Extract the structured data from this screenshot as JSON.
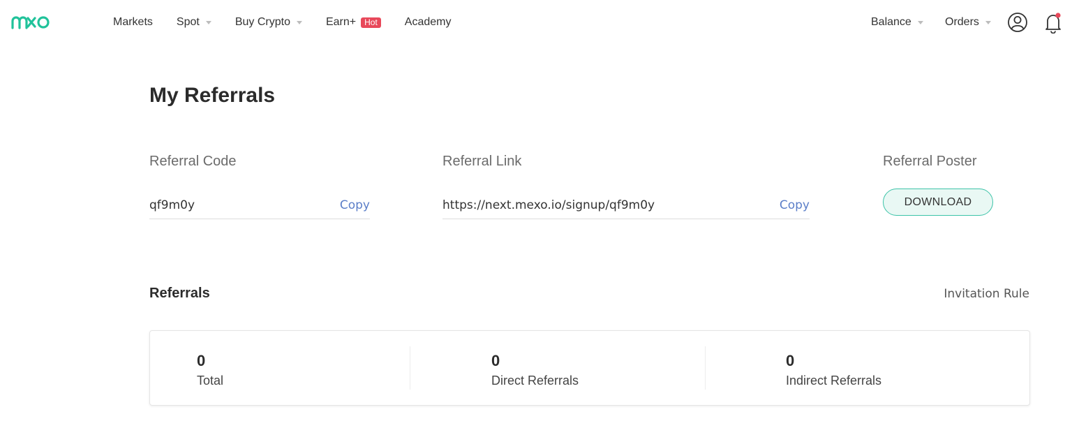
{
  "brand": {
    "logo_text": "mxo",
    "accent": "#20c29a"
  },
  "nav": {
    "items": [
      {
        "label": "Markets",
        "has_dropdown": false
      },
      {
        "label": "Spot",
        "has_dropdown": true
      },
      {
        "label": "Buy Crypto",
        "has_dropdown": true
      },
      {
        "label": "Earn+",
        "has_dropdown": false,
        "badge": "Hot"
      },
      {
        "label": "Academy",
        "has_dropdown": false
      }
    ],
    "right": {
      "balance": "Balance",
      "orders": "Orders",
      "user_icon": "user-circle-icon",
      "bell_icon": "bell-icon",
      "notification_dot_color": "#e8485a"
    }
  },
  "page": {
    "title": "My Referrals",
    "referral_code": {
      "label": "Referral Code",
      "value": "qf9m0y",
      "copy": "Copy"
    },
    "referral_link": {
      "label": "Referral Link",
      "value": "https://next.mexo.io/signup/qf9m0y",
      "copy": "Copy"
    },
    "referral_poster": {
      "label": "Referral Poster",
      "button": "DOWNLOAD"
    },
    "referrals": {
      "title": "Referrals",
      "rule_link": "Invitation Rule",
      "stats": [
        {
          "value": "0",
          "label": "Total"
        },
        {
          "value": "0",
          "label": "Direct Referrals"
        },
        {
          "value": "0",
          "label": "Indirect Referrals"
        }
      ]
    }
  }
}
